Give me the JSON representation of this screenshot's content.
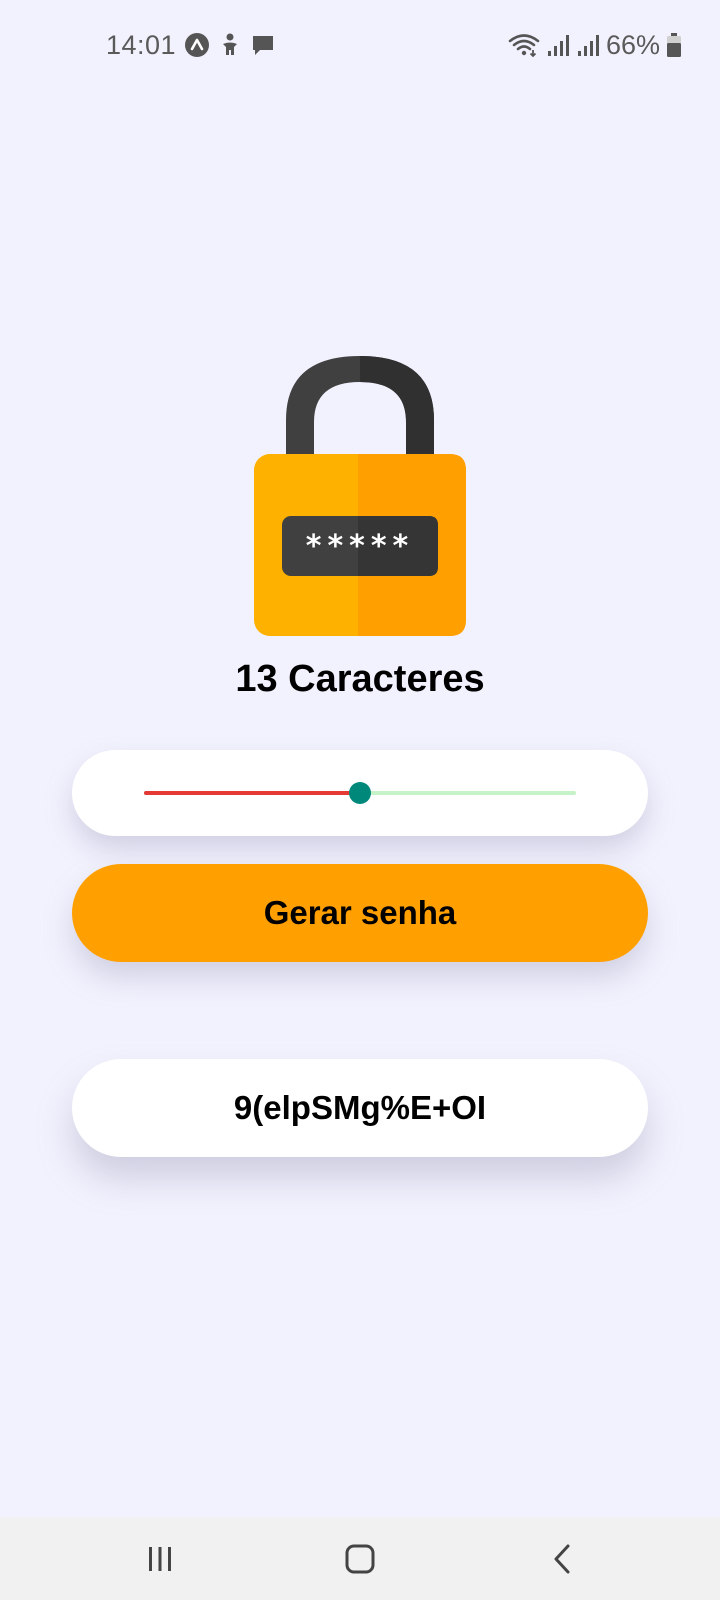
{
  "status_bar": {
    "time": "14:01",
    "battery": "66%",
    "left_icons": [
      "arrow-up-circle-icon",
      "accessibility-icon",
      "chat-icon"
    ],
    "right_icons": [
      "wifi-icon",
      "signal-icon",
      "signal-icon",
      "battery-icon"
    ]
  },
  "lock_icon": "padlock-password-icon",
  "lock_code_mask": "*****",
  "char_count": "13 Caracteres",
  "slider": {
    "value_fraction": 0.5,
    "fill_color": "#e53935",
    "track_color": "#c6f2c8",
    "thumb_color": "#00897b"
  },
  "generate_button": {
    "label": "Gerar senha",
    "color": "#ffa000"
  },
  "password": "9(elpSMg%E+OI",
  "nav_bar": {
    "buttons": [
      "recent-apps-icon",
      "home-icon",
      "back-icon"
    ]
  }
}
